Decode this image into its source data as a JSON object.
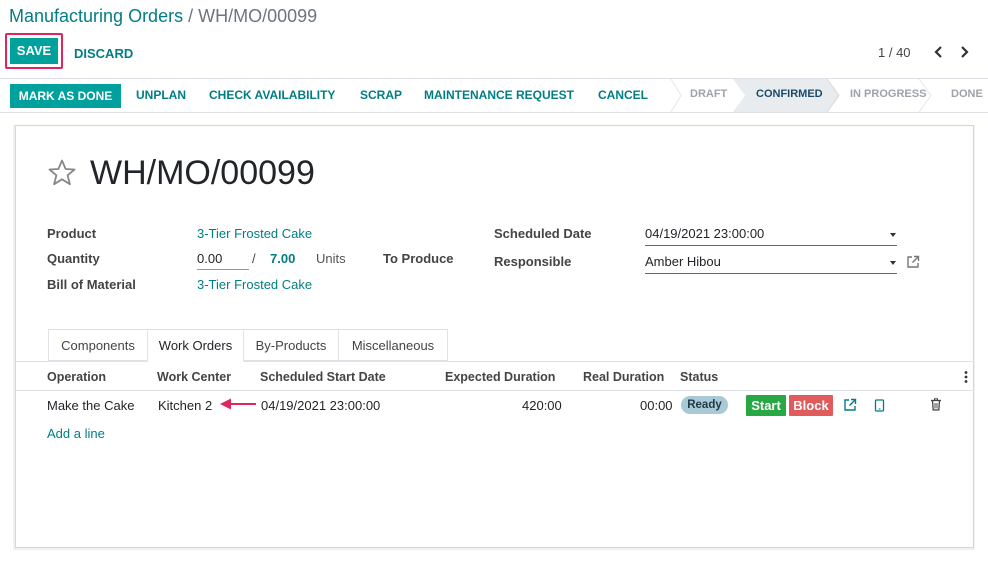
{
  "breadcrumb": {
    "parent": "Manufacturing Orders",
    "separator": "/",
    "current": "WH/MO/00099"
  },
  "control": {
    "save_label": "SAVE",
    "discard_label": "DISCARD",
    "pager": "1 / 40"
  },
  "statusbar": {
    "actions": [
      {
        "label": "MARK AS DONE"
      },
      {
        "label": "UNPLAN"
      },
      {
        "label": "CHECK AVAILABILITY"
      },
      {
        "label": "SCRAP"
      },
      {
        "label": "MAINTENANCE REQUEST"
      },
      {
        "label": "CANCEL"
      }
    ],
    "stages": [
      {
        "label": "DRAFT"
      },
      {
        "label": "CONFIRMED"
      },
      {
        "label": "IN PROGRESS"
      },
      {
        "label": "DONE"
      }
    ],
    "active_stage": "CONFIRMED"
  },
  "record": {
    "title": "WH/MO/00099"
  },
  "form": {
    "product_label": "Product",
    "product_value": "3-Tier Frosted Cake",
    "quantity_label": "Quantity",
    "quantity_done": "0.00",
    "quantity_sep": "/",
    "quantity_total": "7.00",
    "quantity_uom": "Units",
    "to_produce_label": "To Produce",
    "bom_label": "Bill of Material",
    "bom_value": "3-Tier Frosted Cake",
    "scheduled_date_label": "Scheduled Date",
    "scheduled_date_value": "04/19/2021 23:00:00",
    "responsible_label": "Responsible",
    "responsible_value": "Amber Hibou"
  },
  "tabs": [
    {
      "label": "Components"
    },
    {
      "label": "Work Orders"
    },
    {
      "label": "By-Products"
    },
    {
      "label": "Miscellaneous"
    }
  ],
  "active_tab": "Work Orders",
  "work_orders": {
    "columns": [
      "Operation",
      "Work Center",
      "Scheduled Start Date",
      "Expected Duration",
      "Real Duration",
      "Status"
    ],
    "rows": [
      {
        "operation": "Make the Cake",
        "work_center": "Kitchen 2",
        "scheduled_start": "04/19/2021 23:00:00",
        "expected_duration": "420:00",
        "real_duration": "00:00",
        "status": "Ready",
        "start_label": "Start",
        "block_label": "Block"
      }
    ],
    "add_line_label": "Add a line"
  },
  "colors": {
    "primary": "#00a09d",
    "link": "#017e84",
    "highlight": "#e0245e",
    "start": "#28a745",
    "block": "#e05c5c",
    "ready_badge": "#a9c9d7"
  }
}
